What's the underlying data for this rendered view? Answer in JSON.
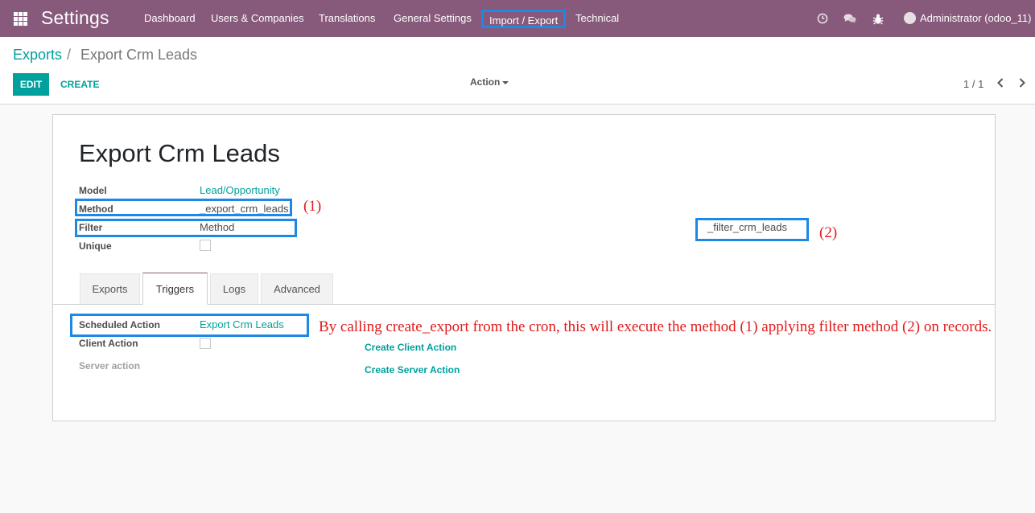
{
  "navbar": {
    "app_title": "Settings",
    "menu": [
      "Dashboard",
      "Users & Companies",
      "Translations",
      "General Settings",
      "Import / Export",
      "Technical"
    ],
    "user": "Administrator (odoo_11)",
    "icons": [
      "apps-grid-icon",
      "clock-icon",
      "chat-icon",
      "bug-icon",
      "avatar"
    ]
  },
  "breadcrumb": {
    "parent": "Exports",
    "separator": "/",
    "current": "Export Crm Leads"
  },
  "buttons": {
    "edit": "EDIT",
    "create": "CREATE",
    "action": "Action"
  },
  "pager": {
    "value": "1 / 1"
  },
  "record": {
    "title": "Export Crm Leads",
    "fields": {
      "model_label": "Model",
      "model_value": "Lead/Opportunity",
      "method_label": "Method",
      "method_value": "_export_crm_leads",
      "filter_label": "Filter",
      "filter_value": "Method",
      "filter_method_value": "_filter_crm_leads",
      "unique_label": "Unique"
    },
    "tabs": [
      "Exports",
      "Triggers",
      "Logs",
      "Advanced"
    ],
    "active_tab": "Triggers",
    "triggers": {
      "scheduled_label": "Scheduled Action",
      "scheduled_value": "Export Crm Leads",
      "client_label": "Client Action",
      "server_label": "Server action",
      "create_client": "Create Client Action",
      "create_server": "Create Server Action"
    }
  },
  "annotations": {
    "marker1": "(1)",
    "marker2": "(2)",
    "note": "By calling create_export from the cron, this will execute the method (1) applying filter method (2) on records."
  },
  "colors": {
    "navbar": "#875a7b",
    "accent": "#00a09d",
    "highlight": "#1e88e5",
    "annotation": "#e31a1c"
  }
}
